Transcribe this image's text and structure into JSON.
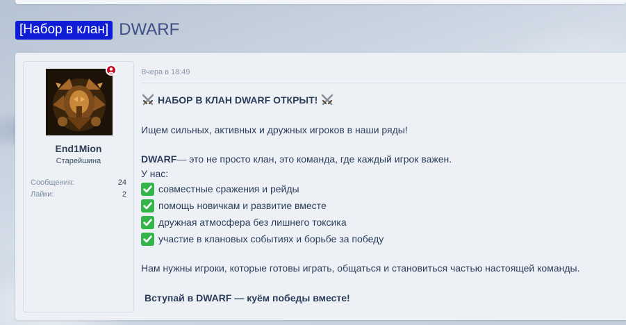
{
  "thread": {
    "prefix": "[Набор в клан]",
    "title": "DWARF"
  },
  "user": {
    "name": "End1Mion",
    "rank": "Старейшина",
    "messages_label": "Сообщения:",
    "messages_value": "24",
    "likes_label": "Лайки:",
    "likes_value": "2",
    "status": "online"
  },
  "post": {
    "date": "Вчера в 18:49",
    "heading": "НАБОР В КЛАН DWARF ОТКРЫТ!",
    "intro": "Ищем сильных, активных и дружных игроков в наши ряды!",
    "clan_name": "DWARF",
    "description": " — это не просто клан, это команда, где каждый игрок важен.",
    "we_have": "У нас:",
    "features": [
      "совместные сражения и рейды",
      "помощь новичкам и развитие вместе",
      "дружная атмосфера без лишнего токсика",
      "участие в клановых событиях и борьбе за победу"
    ],
    "need": "Нам нужны игроки, которые готовы играть, общаться и становиться частью настоящей команды.",
    "cta": "Вступай в DWARF — куём победы вместе!"
  },
  "colors": {
    "prefix_bg": "#0f1ed6",
    "title": "#3d4f83",
    "check_bg": "#33b54a",
    "online": "#c4081e"
  },
  "icons": {
    "heading": "crossed-swords",
    "feature": "check-mark",
    "status": "online-user"
  }
}
